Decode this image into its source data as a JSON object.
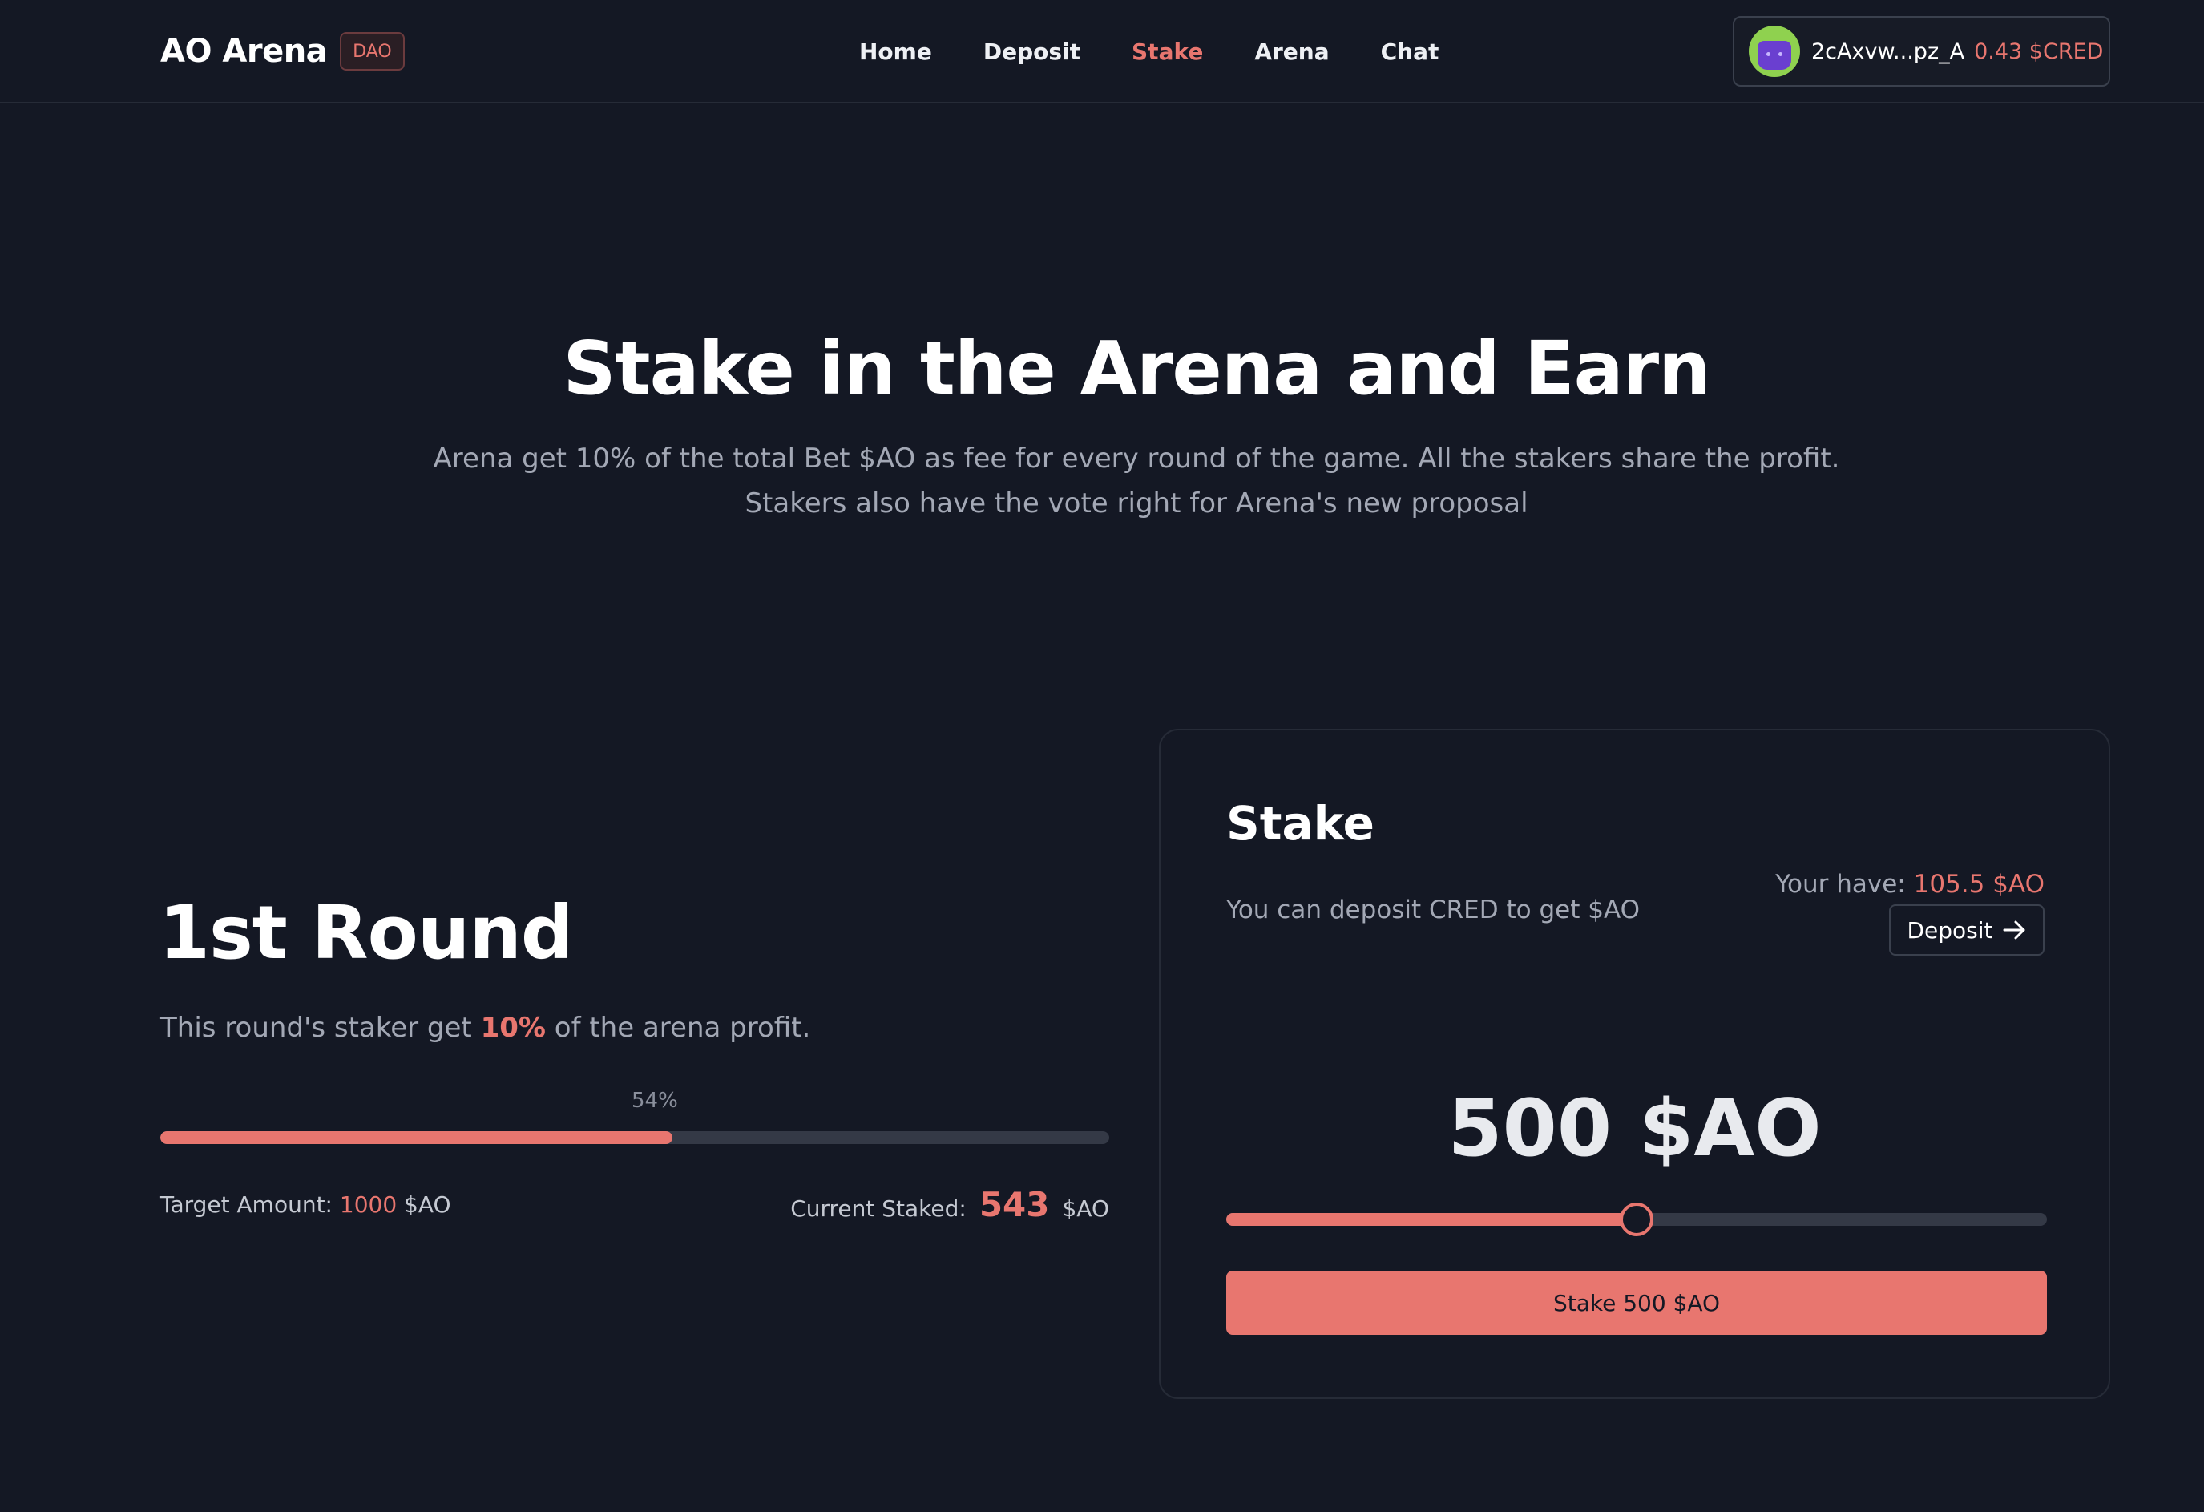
{
  "header": {
    "brand": "AO Arena",
    "badge": "DAO",
    "nav": [
      {
        "label": "Home",
        "active": false
      },
      {
        "label": "Deposit",
        "active": false
      },
      {
        "label": "Stake",
        "active": true
      },
      {
        "label": "Arena",
        "active": false
      },
      {
        "label": "Chat",
        "active": false
      }
    ],
    "wallet": {
      "address": "2cAxvw...pz_A",
      "balance": "0.43 $CRED",
      "avatar_icon": "robot-avatar-icon"
    }
  },
  "hero": {
    "title": "Stake in the Arena and Earn",
    "subtitle_line1": "Arena get 10% of the total Bet $AO as fee for every round of the game. All the stakers share the profit.",
    "subtitle_line2": "Stakers also have the vote right for Arena's new proposal"
  },
  "round": {
    "title": "1st Round",
    "desc_prefix": "This round's staker get ",
    "desc_highlight": "10%",
    "desc_suffix": " of the arena profit.",
    "progress_label": "54%",
    "progress_fraction": 0.54,
    "target_label": "Target Amount: ",
    "target_value": "1000",
    "target_unit": " $AO",
    "current_label": "Current Staked:",
    "current_value": "543",
    "current_unit": "$AO"
  },
  "stake_card": {
    "title": "Stake",
    "info": "You can deposit CRED to get $AO",
    "have_label": "Your have: ",
    "have_value": "105.5 $AO",
    "deposit_label": "Deposit",
    "deposit_icon": "arrow-right-icon",
    "amount": "500 $AO",
    "slider_fraction": 0.5,
    "stake_button": "Stake 500 $AO"
  },
  "colors": {
    "background": "#141824",
    "accent": "#e8766f",
    "muted_text": "#a3a8b5",
    "track": "#343946"
  }
}
